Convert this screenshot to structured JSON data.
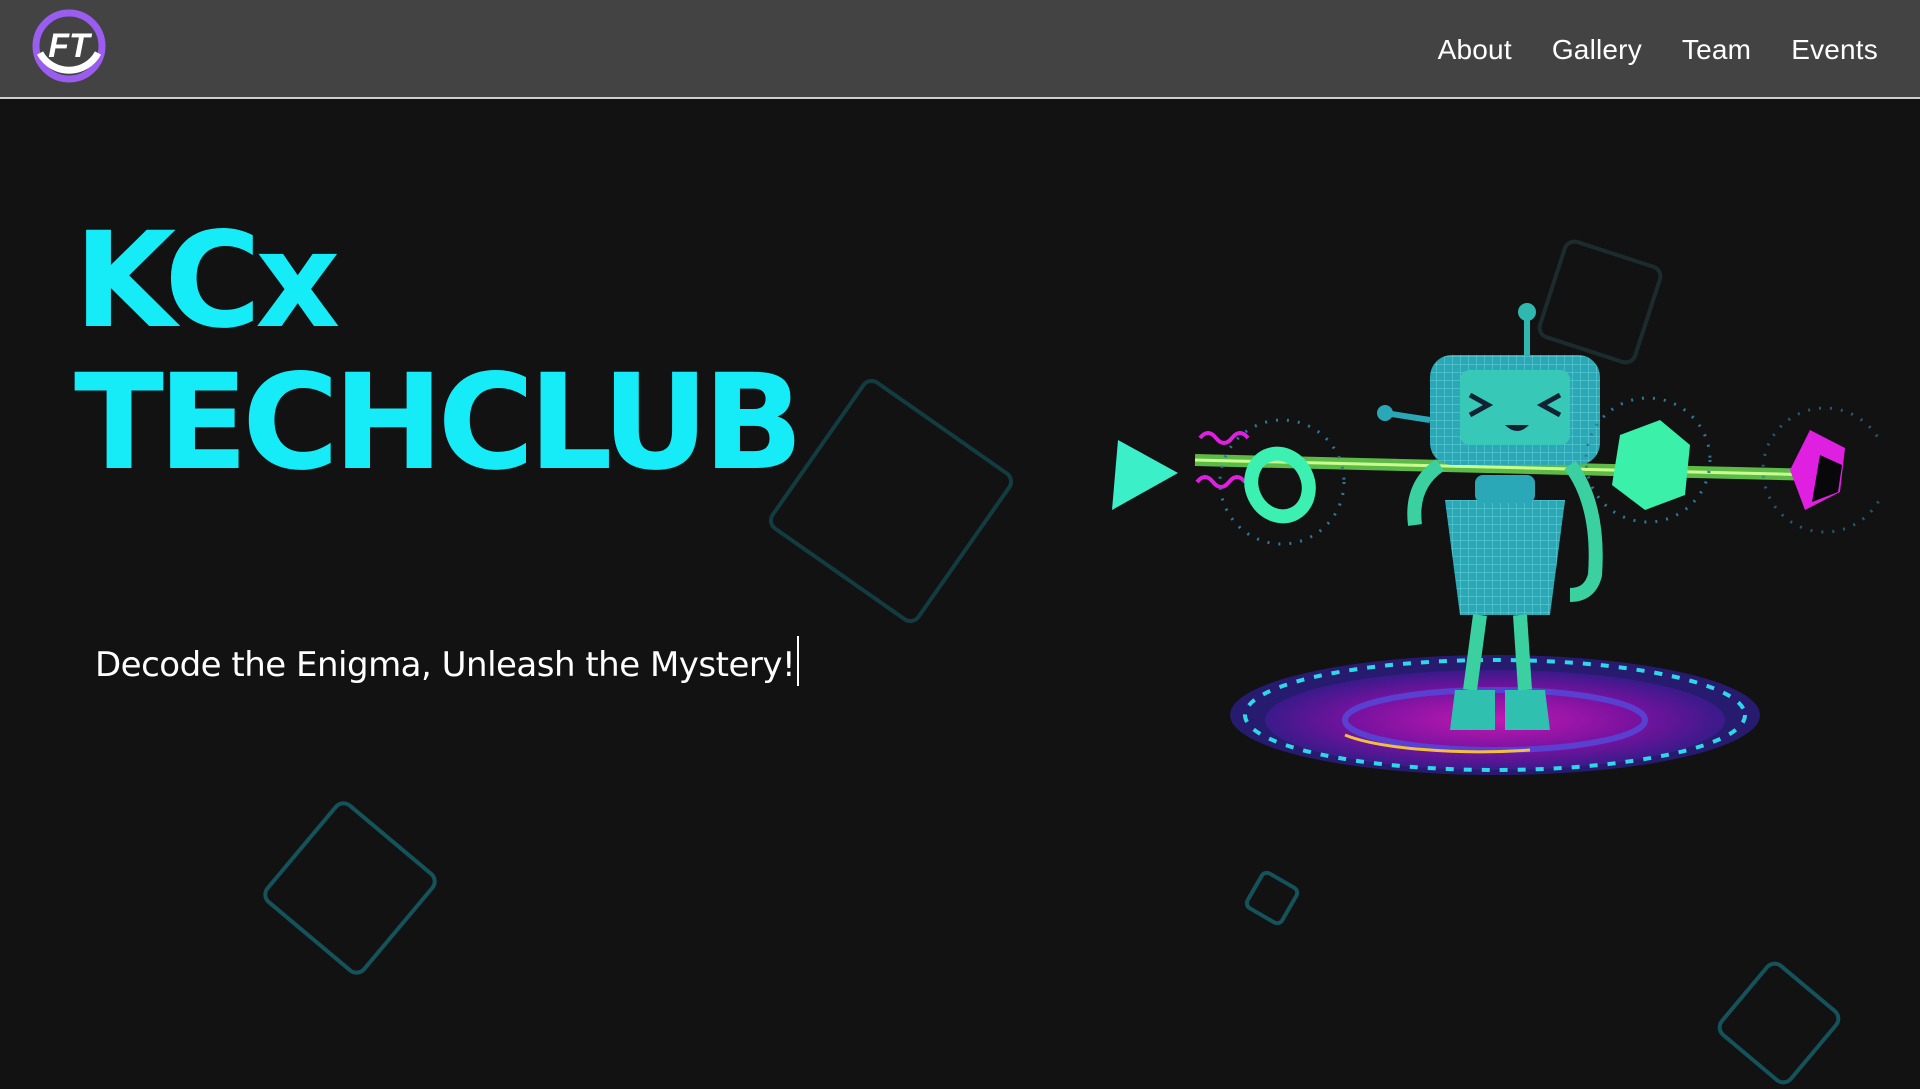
{
  "header": {
    "logo_text": "FT",
    "nav": [
      {
        "label": "About"
      },
      {
        "label": "Gallery"
      },
      {
        "label": "Team"
      },
      {
        "label": "Events"
      }
    ]
  },
  "hero": {
    "title_line1": "KCx",
    "title_line2": "TECHCLUB",
    "tagline": "Decode the Enigma, Unleash the Mystery!"
  },
  "colors": {
    "background": "#121213",
    "navbar": "#434343",
    "accent_cyan": "#16ecf7",
    "logo_purple": "#9b5cf0",
    "magenta": "#e020e0",
    "mint": "#3bf0b0"
  }
}
